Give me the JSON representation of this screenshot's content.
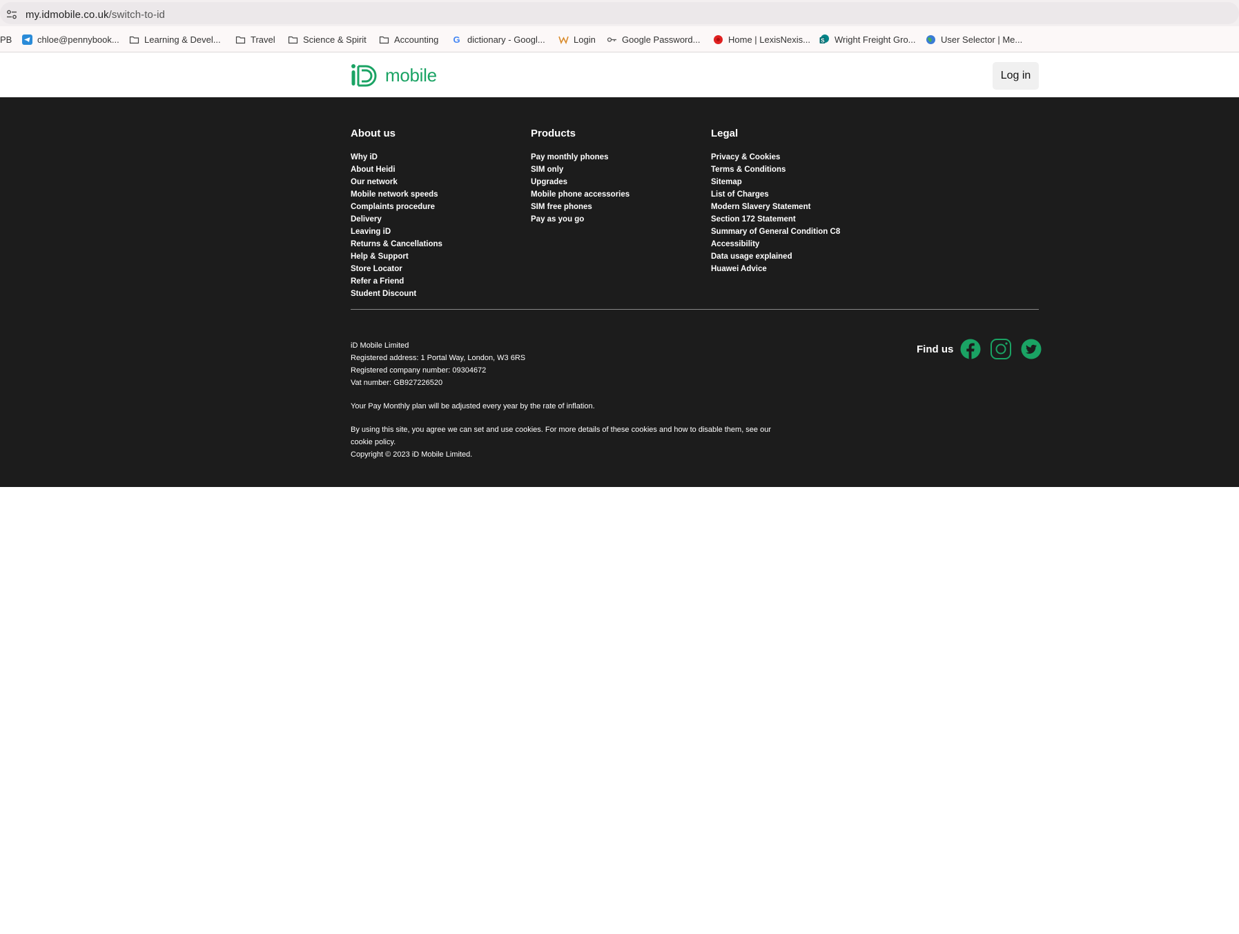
{
  "browser": {
    "url_host": "my.idmobile.co.uk",
    "url_path": "/switch-to-id"
  },
  "bookmarks": [
    {
      "label": "PB",
      "icon": "none"
    },
    {
      "label": "chloe@pennybook...",
      "icon": "telegram-icon"
    },
    {
      "label": "Learning & Devel...",
      "icon": "folder-icon"
    },
    {
      "label": "Travel",
      "icon": "folder-icon"
    },
    {
      "label": "Science & Spirit",
      "icon": "folder-icon"
    },
    {
      "label": "Accounting",
      "icon": "folder-icon"
    },
    {
      "label": "dictionary - Googl...",
      "icon": "google-icon"
    },
    {
      "label": "Login",
      "icon": "w-logo-icon"
    },
    {
      "label": "Google Password...",
      "icon": "key-icon"
    },
    {
      "label": "Home | LexisNexis...",
      "icon": "lexisnexis-icon"
    },
    {
      "label": "Wright Freight Gro...",
      "icon": "sharepoint-icon"
    },
    {
      "label": "User Selector | Me...",
      "icon": "globe-icon"
    }
  ],
  "header": {
    "logo_text": "mobile",
    "login_label": "Log in",
    "brand_color": "#1aa364"
  },
  "footer": {
    "about": {
      "heading": "About us",
      "items": [
        "Why iD",
        "About Heidi",
        "Our network",
        "Mobile network speeds",
        "Complaints procedure",
        "Delivery",
        "Leaving iD",
        "Returns & Cancellations",
        "Help & Support",
        "Store Locator",
        "Refer a Friend",
        "Student Discount"
      ]
    },
    "products": {
      "heading": "Products",
      "items": [
        "Pay monthly phones",
        "SIM only",
        "Upgrades",
        "Mobile phone accessories",
        "SIM free phones",
        "Pay as you go"
      ]
    },
    "legal": {
      "heading": "Legal",
      "items": [
        "Privacy & Cookies",
        "Terms & Conditions",
        "Sitemap",
        "List of Charges",
        "Modern Slavery Statement",
        "Section 172 Statement",
        "Summary of General Condition C8",
        "Accessibility",
        "Data usage explained",
        "Huawei Advice"
      ]
    },
    "company": {
      "name": "iD Mobile Limited",
      "address": "Registered address: 1 Portal Way, London, W3 6RS",
      "company_number": "Registered company number: 09304672",
      "vat": "Vat number: GB927226520"
    },
    "inflation_note": "Your Pay Monthly plan will be adjusted every year by the rate of inflation.",
    "cookie_text": "By using this site, you agree we can set and use cookies. For more details of these cookies and how to disable them, see our",
    "cookie_link": "cookie policy.",
    "copyright": "Copyright © 2023 iD Mobile Limited.",
    "find_us_label": "Find us",
    "social": [
      "facebook-icon",
      "instagram-icon",
      "twitter-icon"
    ]
  }
}
